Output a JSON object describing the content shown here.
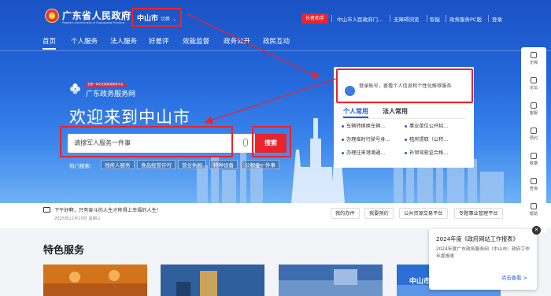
{
  "header": {
    "site_title": "广东省人民政府",
    "site_subtitle": "People's Government of Guangdong Province",
    "city": "中山市",
    "city_switch": "切换",
    "care_mode": "长者助手",
    "links": [
      "中山市人民政府门...",
      "无障碍浏览",
      "智能",
      "政务服务PC版",
      "登录"
    ]
  },
  "nav": {
    "items": [
      "首页",
      "个人服务",
      "法人服务",
      "好差评",
      "效能监督",
      "政务公开",
      "政民互动"
    ]
  },
  "hero": {
    "portal_tag": "全国一体化在线政务服务平台",
    "portal_name": "广东政务服务网",
    "welcome": "欢迎来到中山市",
    "search_value": "请搜军人服务一件事",
    "search_button": "搜索",
    "hot_label": "热门搜索：",
    "hot_tags": [
      "残疾人服务",
      "食品经营许可",
      "营业执照",
      "特种设备",
      "公积金一件事"
    ]
  },
  "login_card": {
    "tip": "登录账号，查看个人信息和个性化推荐服务",
    "tabs": [
      "个人常用",
      "法人常用"
    ],
    "services": [
      "车辆转换换车辆...",
      "事业单位公开招...",
      "办理临时行驶号身...",
      "租房提取（公积...",
      "办理往来港澳通...",
      "补领驾驶证合格..."
    ]
  },
  "info_bar": {
    "greeting": "下午好啊，只有奋斗的人生才称得上幸福的人生！",
    "date": "2025年12月10日 星期三",
    "buttons": [
      "我的办件",
      "我要预约",
      "公共资源交易平台",
      "专题事业管理平台"
    ]
  },
  "section": {
    "title": "特色服务",
    "card4_label": "中山市"
  },
  "rail": {
    "items": [
      "无障",
      "论坛",
      "客服",
      "预约",
      "数据",
      "查询",
      "帮助"
    ]
  },
  "popup": {
    "title": "2024年度《政府网站工作报表》",
    "body": "2024年度广东政务服务网（中山市）政府工作年度报表",
    "more": "点击查看 >"
  },
  "colors": {
    "primary": "#1d5fd6",
    "accent": "#e8242d",
    "hero_top": "#1a52c4"
  }
}
